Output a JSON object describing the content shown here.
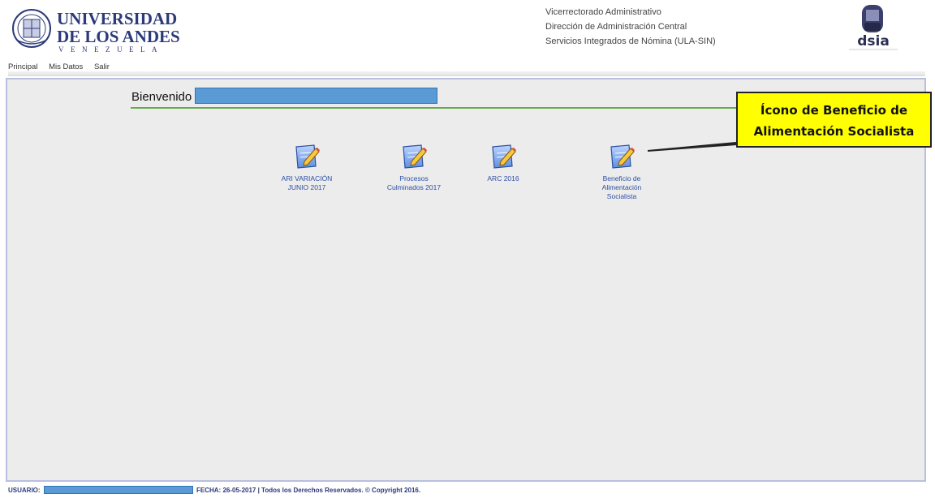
{
  "header": {
    "logo": {
      "line1": "UNIVERSIDAD",
      "line2": "DE LOS ANDES",
      "line3": "VENEZUELA"
    },
    "org_lines": [
      "Vicerrectorado Administrativo",
      "Dirección de Administración Central",
      "Servicios Integrados de Nómina (ULA-SIN)"
    ],
    "dsia_logo_text": "dsia"
  },
  "nav": {
    "items": [
      "Principal",
      "Mis Datos",
      "Salir"
    ]
  },
  "main": {
    "welcome_label": "Bienvenido",
    "welcome_value": "",
    "tiles": [
      {
        "label": "ARI VARIACIÓN\nJUNIO 2017",
        "icon": "edit-document-icon"
      },
      {
        "label": "Procesos\nCulminados 2017",
        "icon": "edit-document-icon"
      },
      {
        "label": "ARC 2016",
        "icon": "edit-document-icon"
      },
      {
        "label": "Beneficio de\nAlimentación\nSocialista",
        "icon": "edit-document-icon"
      }
    ]
  },
  "callout": {
    "text": "Ícono de Beneficio de\nAlimentación Socialista"
  },
  "footer": {
    "user_label": "USUARIO:",
    "user_value": "",
    "info": "FECHA: 26-05-2017 | Todos los Derechos Reservados. © Copyright 2016."
  },
  "colors": {
    "panel_bg": "#ececec",
    "panel_border": "#b8bfdf",
    "redaction": "#5b9bd5",
    "rule_green": "#6aa84f",
    "callout_yellow": "#ffff00",
    "link_blue": "#2c4ea3"
  }
}
